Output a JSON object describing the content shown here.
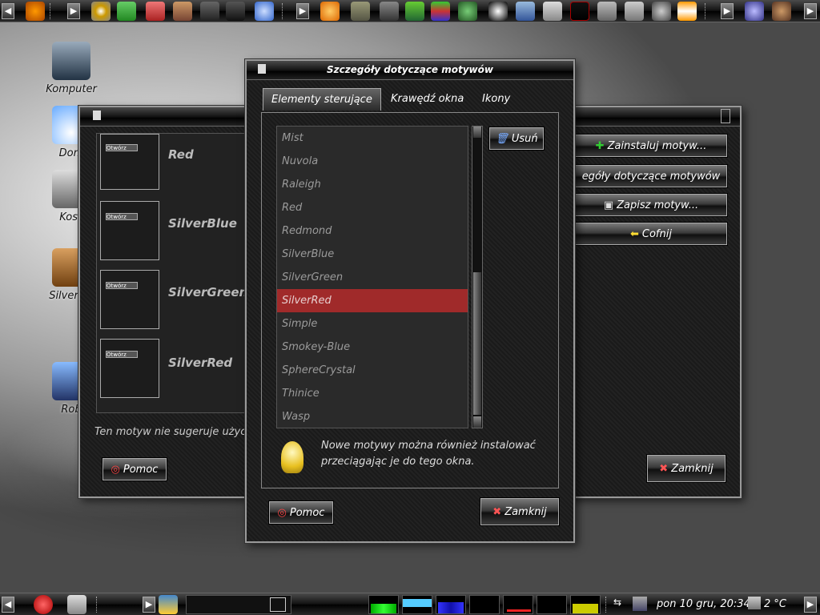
{
  "desktop": {
    "icons": [
      {
        "label": "Komputer"
      },
      {
        "label": "Dom"
      },
      {
        "label": "Kosz"
      },
      {
        "label": "SilverRG"
      },
      {
        "label": "Rob"
      }
    ]
  },
  "back_window": {
    "themes": [
      {
        "name": "Red"
      },
      {
        "name": "SilverBlue"
      },
      {
        "name": "SilverGreen"
      },
      {
        "name": "SilverRed"
      }
    ],
    "preview_button": "Otwórz",
    "notice": "Ten motyw nie sugeruje użyc",
    "help_button": "Pomoc",
    "buttons": {
      "install": "Zainstaluj motyw...",
      "details": "egóły dotyczące motywów",
      "save": "Zapisz motyw...",
      "back": "Cofnij",
      "close": "Zamknij"
    }
  },
  "dialog": {
    "title": "Szczegóły dotyczące motywów",
    "tabs": [
      "Elementy sterujące",
      "Krawędź okna",
      "Ikony"
    ],
    "active_tab": "Elementy sterujące",
    "items": [
      "Mist",
      "Nuvola",
      "Raleigh",
      "Red",
      "Redmond",
      "SilverBlue",
      "SilverGreen",
      "SilverRed",
      "Simple",
      "Smokey-Blue",
      "SphereCrystal",
      "Thinice",
      "Wasp"
    ],
    "selected": "SilverRed",
    "remove_button": "Usuń",
    "hint": "Nowe motywy można również instalować przeciągając je do tego okna.",
    "help_button": "Pomoc",
    "close_button": "Zamknij"
  },
  "taskbar": {
    "clock": "pon 10 gru, 20:34",
    "temperature": "2 °C"
  },
  "colors": {
    "selection": "#a02a2a",
    "accent": "#ffffff"
  }
}
